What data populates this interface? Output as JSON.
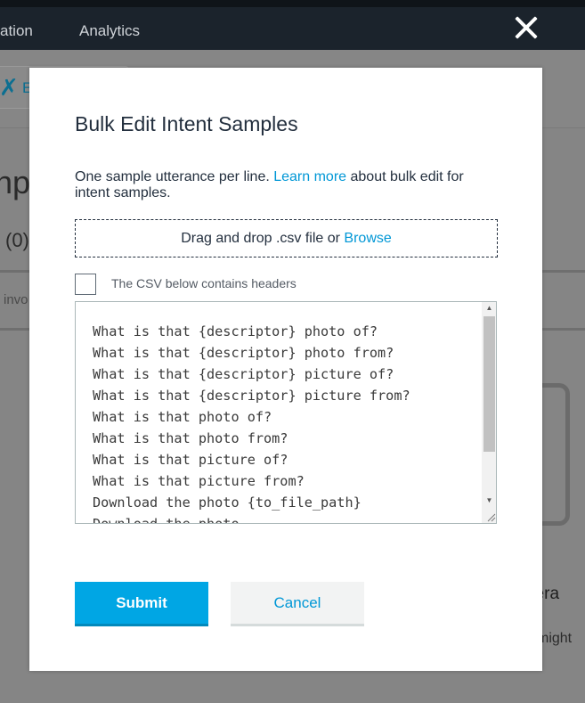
{
  "background": {
    "nav_items": [
      "ation",
      "Analytics"
    ],
    "chip_label": "E",
    "heading_fragment": "npl",
    "count_fragment": "(0)",
    "row_fragment": "invo",
    "right_fragment_1": "ttera",
    "right_fragment_2": "might"
  },
  "modal": {
    "title": "Bulk Edit Intent Samples",
    "description_prefix": "One sample utterance per line. ",
    "learn_more": "Learn more",
    "description_suffix": " about bulk edit for intent samples.",
    "dropzone_text": "Drag and drop .csv file or ",
    "browse": "Browse",
    "csv_headers_label": "The CSV below contains headers",
    "csv_headers_checked": false,
    "utterances": [
      "What is that {descriptor} photo of?",
      "What is that {descriptor} photo from?",
      "What is that {descriptor} picture of?",
      "What is that {descriptor} picture from?",
      "What is that photo of?",
      "What is that photo from?",
      "What is that picture of?",
      "What is that picture from?",
      "Download the photo {to_file_path}",
      "Download the photo"
    ],
    "submit_label": "Submit",
    "cancel_label": "Cancel"
  },
  "colors": {
    "accent": "#00a6e4",
    "link": "#0097d6",
    "text": "#232f3e"
  }
}
